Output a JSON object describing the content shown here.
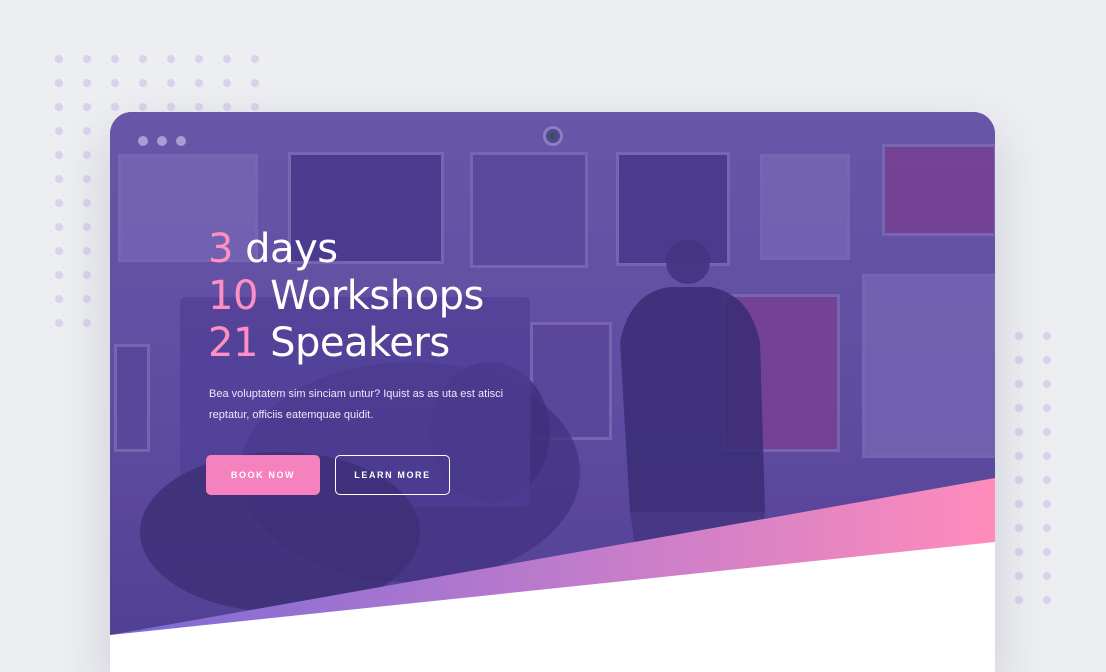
{
  "hero": {
    "stats": [
      {
        "number": "3",
        "label": " days"
      },
      {
        "number": "10",
        "label": " Workshops"
      },
      {
        "number": "21",
        "label": " Speakers"
      }
    ],
    "description": "Bea voluptatem sim sinciam untur? Iquist as as uta est atisci reptatur, officiis eatemquae quidit.",
    "book_label": "BOOK NOW",
    "learn_label": "LEARN MORE"
  },
  "colors": {
    "accent_pink": "#ff8fc3",
    "button_pink": "#f681bf",
    "overlay_purple": "#6a59a6",
    "gradient_start": "#7a6ad6",
    "gradient_end": "#ff8cbb",
    "background": "#eceef1"
  },
  "icons": {
    "camera": "webcam-icon",
    "window_controls": "window-dots-icon"
  }
}
